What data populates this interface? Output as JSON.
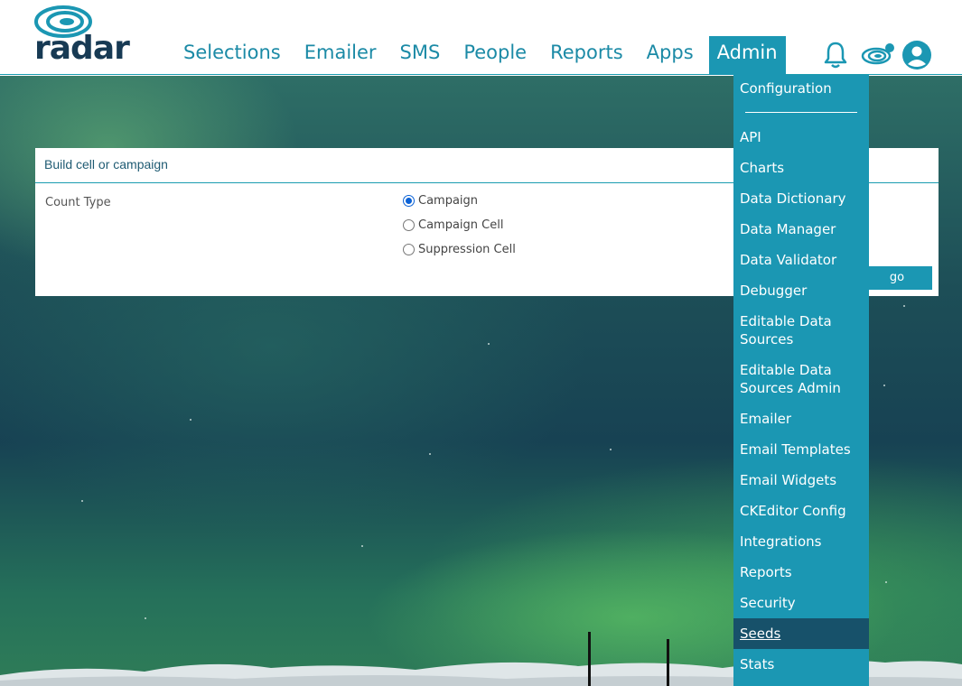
{
  "brand": {
    "logo_text": "radar"
  },
  "nav": {
    "items": [
      {
        "label": "Selections"
      },
      {
        "label": "Emailer"
      },
      {
        "label": "SMS"
      },
      {
        "label": "People"
      },
      {
        "label": "Reports"
      },
      {
        "label": "Apps"
      },
      {
        "label": "Admin"
      }
    ]
  },
  "panel": {
    "title": "Build cell or campaign",
    "count_type_label": "Count Type",
    "options": [
      {
        "label": "Campaign",
        "checked": true
      },
      {
        "label": "Campaign Cell",
        "checked": false
      },
      {
        "label": "Suppression Cell",
        "checked": false
      }
    ],
    "go_label": "go"
  },
  "admin_menu": {
    "items": [
      {
        "label": "Configuration"
      },
      {
        "label": "API"
      },
      {
        "label": "Charts"
      },
      {
        "label": "Data Dictionary"
      },
      {
        "label": "Data Manager"
      },
      {
        "label": "Data Validator"
      },
      {
        "label": "Debugger"
      },
      {
        "label": "Editable Data Sources"
      },
      {
        "label": "Editable Data Sources Admin"
      },
      {
        "label": "Emailer"
      },
      {
        "label": "Email Templates"
      },
      {
        "label": "Email Widgets"
      },
      {
        "label": "CKEditor Config"
      },
      {
        "label": "Integrations"
      },
      {
        "label": "Reports"
      },
      {
        "label": "Security"
      },
      {
        "label": "Seeds"
      },
      {
        "label": "Stats"
      }
    ],
    "selected": "Seeds"
  },
  "colors": {
    "accent": "#1b97b3",
    "brand_dark": "#173a54",
    "selected_item": "#17516a"
  },
  "icons": [
    "notification-bell-icon",
    "radar-icon",
    "user-avatar-icon"
  ]
}
